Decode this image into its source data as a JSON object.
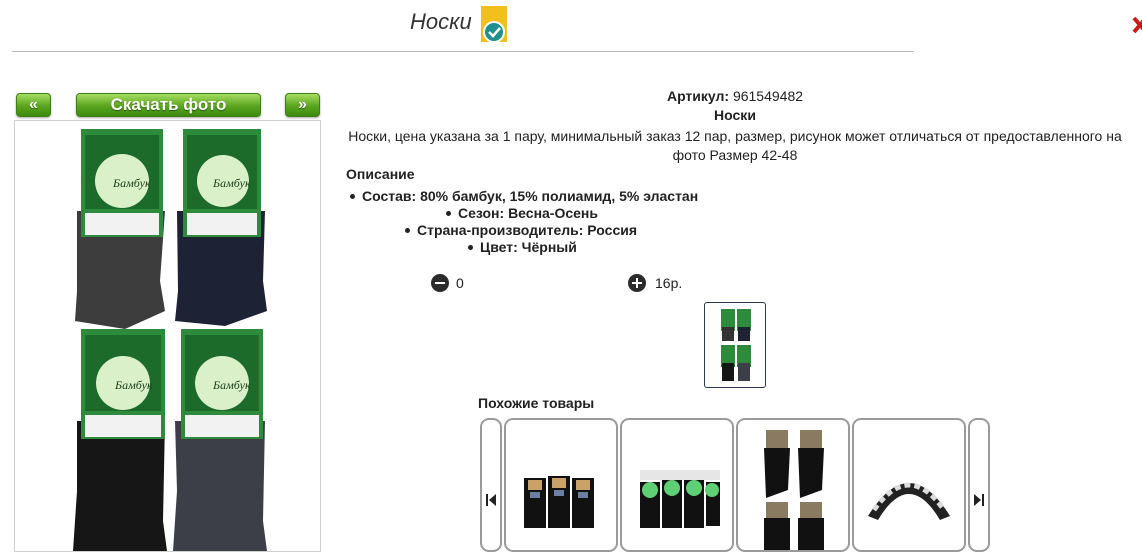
{
  "header": {
    "title": "Носки"
  },
  "gallery": {
    "prev_label": "«",
    "download_label": "Скачать фото",
    "next_label": "»",
    "pack_brand": "Бамбук"
  },
  "product": {
    "sku_label": "Артикул:",
    "sku_value": "961549482",
    "name": "Носки",
    "description": "Носки, цена указана за 1 пару, минимальный заказ 12 пар, размер, рисунок может отличаться от предоставленного на фото Размер 42-48",
    "description_heading": "Описание",
    "specs": [
      "Состав: 80% бамбук, 15% полиамид, 5% эластан",
      "Сезон: Весна-Осень",
      "Страна-производитель: Россия",
      "Цвет: Чёрный"
    ]
  },
  "purchase": {
    "quantity": "0",
    "price": "16р."
  },
  "similar": {
    "heading": "Похожие товары"
  },
  "colors": {
    "accent_green": "#5aa51e",
    "badge_yellow": "#f2c01c",
    "badge_teal": "#1f8f8f",
    "close_red": "#cc1b1b"
  },
  "icons": [
    "verified-badge-icon",
    "close-icon",
    "minus-icon",
    "plus-icon",
    "arrow-left-icon",
    "arrow-right-icon"
  ]
}
